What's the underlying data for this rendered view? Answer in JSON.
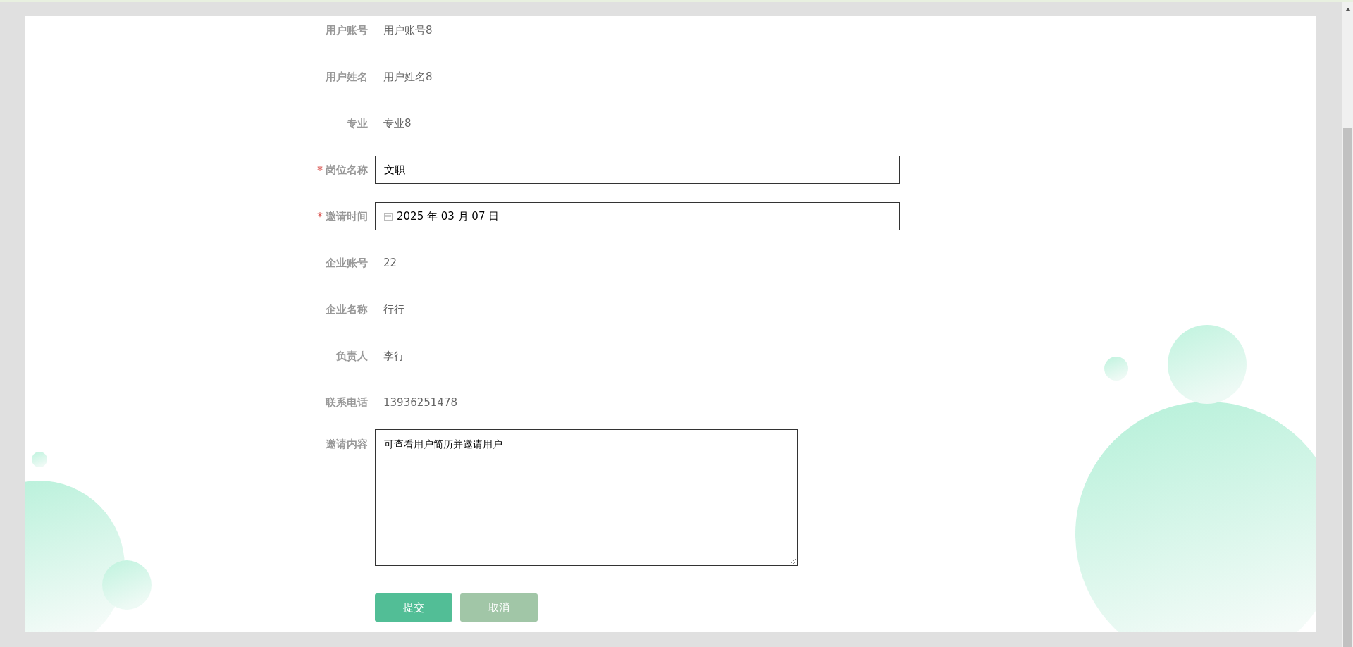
{
  "form": {
    "rows": [
      {
        "label": "用户账号",
        "kind": "text",
        "required": false,
        "value": "用户账号8"
      },
      {
        "label": "用户姓名",
        "kind": "text",
        "required": false,
        "value": "用户姓名8"
      },
      {
        "label": "专业",
        "kind": "text",
        "required": false,
        "value": "专业8"
      },
      {
        "label": "岗位名称",
        "kind": "input",
        "required": true,
        "value": "文职"
      },
      {
        "label": "邀请时间",
        "kind": "date",
        "required": true,
        "value": "2025 年 03 月 07 日"
      },
      {
        "label": "企业账号",
        "kind": "text",
        "required": false,
        "value": "22"
      },
      {
        "label": "企业名称",
        "kind": "text",
        "required": false,
        "value": "行行"
      },
      {
        "label": "负责人",
        "kind": "text",
        "required": false,
        "value": "李行"
      },
      {
        "label": "联系电话",
        "kind": "text",
        "required": false,
        "value": "13936251478"
      },
      {
        "label": "邀请内容",
        "kind": "textarea",
        "required": false,
        "value": "可查看用户简历并邀请用户"
      }
    ],
    "required_mark": "*",
    "buttons": [
      {
        "label": "提交",
        "kind": "primary"
      },
      {
        "label": "取消",
        "kind": "secondary"
      }
    ]
  }
}
